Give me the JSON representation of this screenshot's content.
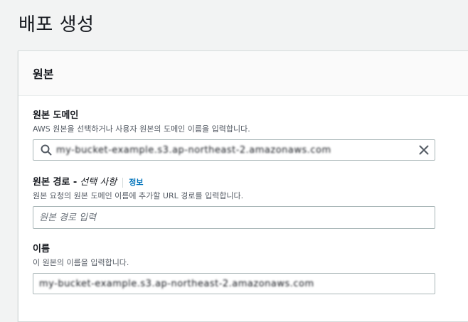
{
  "page": {
    "title": "배포 생성"
  },
  "origin_panel": {
    "title": "원본",
    "origin_domain": {
      "label": "원본 도메인",
      "description": "AWS 원본을 선택하거나 사용자 원본의 도메인 이름을 입력합니다.",
      "value": "my-bucket-example.s3.ap-northeast-2.amazonaws.com",
      "icons": [
        "search-icon",
        "close-icon"
      ]
    },
    "origin_path": {
      "label": "원본 경로 -",
      "optional": "선택 사항",
      "info_link": "정보",
      "description": "원본 요청의 원본 도메인 이름에 추가할 URL 경로를 입력합니다.",
      "placeholder": "원본 경로 입력",
      "value": ""
    },
    "name": {
      "label": "이름",
      "description": "이 원본의 이름을 입력합니다.",
      "value": "my-bucket-example.s3.ap-northeast-2.amazonaws.com"
    }
  },
  "colors": {
    "link": "#0073bb",
    "border": "#aab7b8",
    "background": "#f2f3f3"
  }
}
